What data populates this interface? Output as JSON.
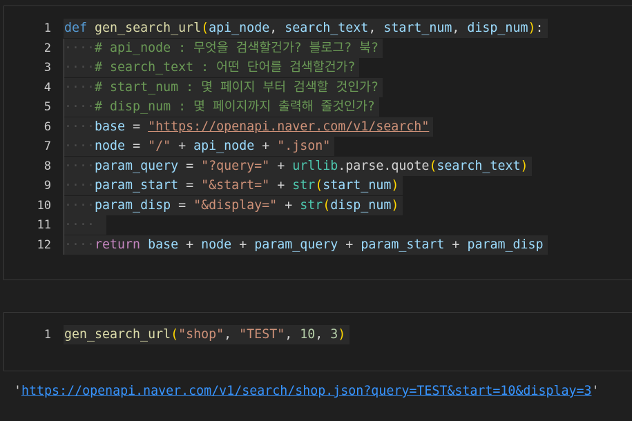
{
  "cell1": {
    "lines": [
      {
        "num": "1",
        "indent": "",
        "tokens": [
          {
            "t": "def",
            "c": "kw"
          },
          {
            "t": " ",
            "c": "op"
          },
          {
            "t": "gen_search_url",
            "c": "fn"
          },
          {
            "t": "(",
            "c": "pa"
          },
          {
            "t": "api_node",
            "c": "pm"
          },
          {
            "t": ", ",
            "c": "op"
          },
          {
            "t": "search_text",
            "c": "pm"
          },
          {
            "t": ", ",
            "c": "op"
          },
          {
            "t": "start_num",
            "c": "pm"
          },
          {
            "t": ", ",
            "c": "op"
          },
          {
            "t": "disp_num",
            "c": "pm"
          },
          {
            "t": ")",
            "c": "pa"
          },
          {
            "t": ":",
            "c": "op"
          }
        ]
      },
      {
        "num": "2",
        "indent": "····",
        "tokens": [
          {
            "t": "# api_node : 무엇을 검색할건가? 블로그? 북?",
            "c": "cm"
          }
        ]
      },
      {
        "num": "3",
        "indent": "····",
        "tokens": [
          {
            "t": "# search_text : 어떤 단어를 검색할건가?",
            "c": "cm"
          }
        ]
      },
      {
        "num": "4",
        "indent": "····",
        "tokens": [
          {
            "t": "# start_num : 몇 페이지 부터 검색할 것인가?",
            "c": "cm"
          }
        ]
      },
      {
        "num": "5",
        "indent": "····",
        "tokens": [
          {
            "t": "# disp_num : 몇 페이지까지 출력해 줄것인가?",
            "c": "cm"
          }
        ]
      },
      {
        "num": "6",
        "indent": "····",
        "tokens": [
          {
            "t": "base",
            "c": "va"
          },
          {
            "t": " = ",
            "c": "op"
          },
          {
            "t": "\"https://openapi.naver.com/v1/search\"",
            "c": "st url"
          }
        ]
      },
      {
        "num": "7",
        "indent": "····",
        "tokens": [
          {
            "t": "node",
            "c": "va"
          },
          {
            "t": " = ",
            "c": "op"
          },
          {
            "t": "\"/\"",
            "c": "st"
          },
          {
            "t": " + ",
            "c": "op"
          },
          {
            "t": "api_node",
            "c": "va"
          },
          {
            "t": " + ",
            "c": "op"
          },
          {
            "t": "\".json\"",
            "c": "st"
          }
        ]
      },
      {
        "num": "8",
        "indent": "····",
        "tokens": [
          {
            "t": "param_query",
            "c": "va"
          },
          {
            "t": " = ",
            "c": "op"
          },
          {
            "t": "\"?query=\"",
            "c": "st"
          },
          {
            "t": " + ",
            "c": "op"
          },
          {
            "t": "urllib",
            "c": "mo"
          },
          {
            "t": ".",
            "c": "op"
          },
          {
            "t": "parse",
            "c": "op"
          },
          {
            "t": ".",
            "c": "op"
          },
          {
            "t": "quote",
            "c": "op"
          },
          {
            "t": "(",
            "c": "pa"
          },
          {
            "t": "search_text",
            "c": "va"
          },
          {
            "t": ")",
            "c": "pa"
          }
        ]
      },
      {
        "num": "9",
        "indent": "····",
        "tokens": [
          {
            "t": "param_start",
            "c": "va"
          },
          {
            "t": " = ",
            "c": "op"
          },
          {
            "t": "\"&start=\"",
            "c": "st"
          },
          {
            "t": " + ",
            "c": "op"
          },
          {
            "t": "str",
            "c": "bi"
          },
          {
            "t": "(",
            "c": "pa"
          },
          {
            "t": "start_num",
            "c": "va"
          },
          {
            "t": ")",
            "c": "pa"
          }
        ]
      },
      {
        "num": "10",
        "indent": "····",
        "tokens": [
          {
            "t": "param_disp",
            "c": "va"
          },
          {
            "t": " = ",
            "c": "op"
          },
          {
            "t": "\"&display=\"",
            "c": "st"
          },
          {
            "t": " + ",
            "c": "op"
          },
          {
            "t": "str",
            "c": "bi"
          },
          {
            "t": "(",
            "c": "pa"
          },
          {
            "t": "disp_num",
            "c": "va"
          },
          {
            "t": ")",
            "c": "pa"
          }
        ]
      },
      {
        "num": "11",
        "indent": "····",
        "tokens": [
          {
            "t": " ",
            "c": "op"
          }
        ]
      },
      {
        "num": "12",
        "indent": "····",
        "tokens": [
          {
            "t": "return",
            "c": "ctl"
          },
          {
            "t": " ",
            "c": "op"
          },
          {
            "t": "base",
            "c": "va"
          },
          {
            "t": " + ",
            "c": "op"
          },
          {
            "t": "node",
            "c": "va"
          },
          {
            "t": " + ",
            "c": "op"
          },
          {
            "t": "param_query",
            "c": "va"
          },
          {
            "t": " + ",
            "c": "op"
          },
          {
            "t": "param_start",
            "c": "va"
          },
          {
            "t": " + ",
            "c": "op"
          },
          {
            "t": "param_disp",
            "c": "va"
          }
        ]
      }
    ]
  },
  "cell2": {
    "lines": [
      {
        "num": "1",
        "indent": "",
        "tokens": [
          {
            "t": "gen_search_url",
            "c": "fn"
          },
          {
            "t": "(",
            "c": "pa"
          },
          {
            "t": "\"shop\"",
            "c": "st"
          },
          {
            "t": ", ",
            "c": "op"
          },
          {
            "t": "\"TEST\"",
            "c": "st"
          },
          {
            "t": ", ",
            "c": "op"
          },
          {
            "t": "10",
            "c": "nu"
          },
          {
            "t": ", ",
            "c": "op"
          },
          {
            "t": "3",
            "c": "nu"
          },
          {
            "t": ")",
            "c": "pa"
          }
        ]
      }
    ]
  },
  "output": {
    "quote_open": "'",
    "link": "https://openapi.naver.com/v1/search/shop.json?query=TEST&start=10&display=3",
    "quote_close": "'"
  }
}
